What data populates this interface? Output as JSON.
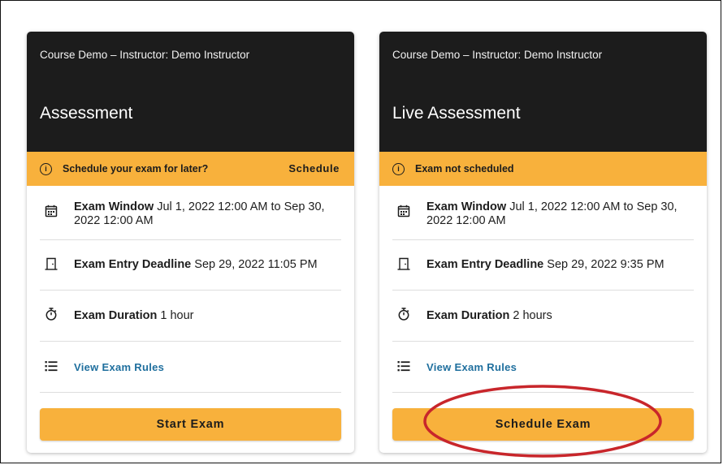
{
  "cards": [
    {
      "course": "Course Demo – Instructor: Demo Instructor",
      "title": "Assessment",
      "notice_text": "Schedule your exam for later?",
      "notice_action": "Schedule",
      "window_label": "Exam Window",
      "window_value": "Jul 1, 2022 12:00 AM to Sep 30, 2022 12:00 AM",
      "deadline_label": "Exam Entry Deadline",
      "deadline_value": "Sep 29, 2022 11:05 PM",
      "duration_label": "Exam Duration",
      "duration_value": "1 hour",
      "rules_link": "View Exam Rules",
      "action_label": "Start Exam"
    },
    {
      "course": "Course Demo – Instructor: Demo Instructor",
      "title": "Live Assessment",
      "notice_text": "Exam not scheduled",
      "window_label": "Exam Window",
      "window_value": "Jul 1, 2022 12:00 AM to Sep 30, 2022 12:00 AM",
      "deadline_label": "Exam Entry Deadline",
      "deadline_value": "Sep 29, 2022 9:35 PM",
      "duration_label": "Exam Duration",
      "duration_value": "2 hours",
      "rules_link": "View Exam Rules",
      "action_label": "Schedule Exam"
    }
  ],
  "colors": {
    "header_bg": "#1c1c1c",
    "accent": "#f8b13c",
    "link": "#1f6f9e",
    "annotation": "#c8262b"
  },
  "icons": {
    "info": "info-icon",
    "window": "calendar-icon",
    "deadline": "door-entry-icon",
    "duration": "stopwatch-icon",
    "rules": "list-icon"
  }
}
